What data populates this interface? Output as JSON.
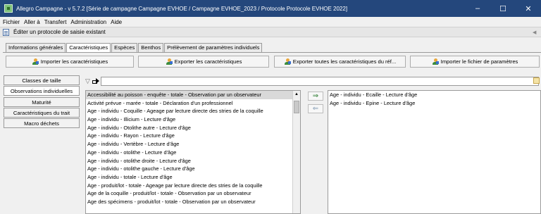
{
  "window": {
    "title": "Allegro Campagne - v 5.7.2 [Série de campagne Campagne EVHOE / Campagne EVHOE_2023 / Protocole Protocole EVHOE 2022]",
    "controls": {
      "minimize": "–",
      "maximize": "☐",
      "close": "✕"
    }
  },
  "menu": [
    "Fichier",
    "Aller à",
    "Transfert",
    "Administration",
    "Aide"
  ],
  "subheader": {
    "title": "Éditer un protocole de saisie existant"
  },
  "tabs": [
    {
      "label": "Informations générales",
      "active": false
    },
    {
      "label": "Caractéristiques",
      "active": true
    },
    {
      "label": "Espèces",
      "active": false
    },
    {
      "label": "Benthos",
      "active": false
    },
    {
      "label": "Prélèvement de paramètres individuels",
      "active": false
    }
  ],
  "toolbar": {
    "import_label": "Importer les caractéristiques",
    "export_label": "Exporter les caractéristiques",
    "export_all_label": "Exporter toutes les caractéristiques du réf...",
    "import_params_label": "Importer le fichier de paramètres"
  },
  "sidebar": {
    "items": [
      {
        "label": "Classes de taille",
        "active": false
      },
      {
        "label": "Observations individuelles",
        "active": true
      },
      {
        "label": "Maturité",
        "active": false
      },
      {
        "label": "Caractéristiques du trait",
        "active": false
      },
      {
        "label": "Macro déchets",
        "active": false
      }
    ]
  },
  "filter": {
    "value": "",
    "icons": [
      "filter-icon",
      "arrow-icon"
    ]
  },
  "available_list": [
    "Accessibilité au poisson - enquête - totale - Observation par un observateur",
    "Activité prévue  - marée - totale - Déclaration d'un professionnel",
    "Age - individu - Coquille - Ageage par lecture directe des stries de la coquille",
    "Age - individu - Illicium - Lecture d'âge",
    "Age - individu - Otolithe autre - Lecture d'âge",
    "Age - individu - Rayon - Lecture d'âge",
    "Age - individu - Vertèbre - Lecture d'âge",
    "Age - individu - otolithe - Lecture d'âge",
    "Age - individu - otolithe droite - Lecture d'âge",
    "Age - individu - otolithe gauche - Lecture d'âge",
    "Age - individu - totale - Lecture d'âge",
    "Age - produit/lot - totale - Ageage par lecture directe des stries de la coquille",
    "Age de la coquille - produit/lot - totale - Observation par un observateur",
    "Age des spécimens - produit/lot - totale - Observation par un observateur"
  ],
  "selected_list": [
    "Age - individu - Ecaille - Lecture d'âge",
    "Age - individu - Epine - Lecture d'âge"
  ],
  "move_buttons": {
    "add": "⇒",
    "remove": "⇐"
  }
}
